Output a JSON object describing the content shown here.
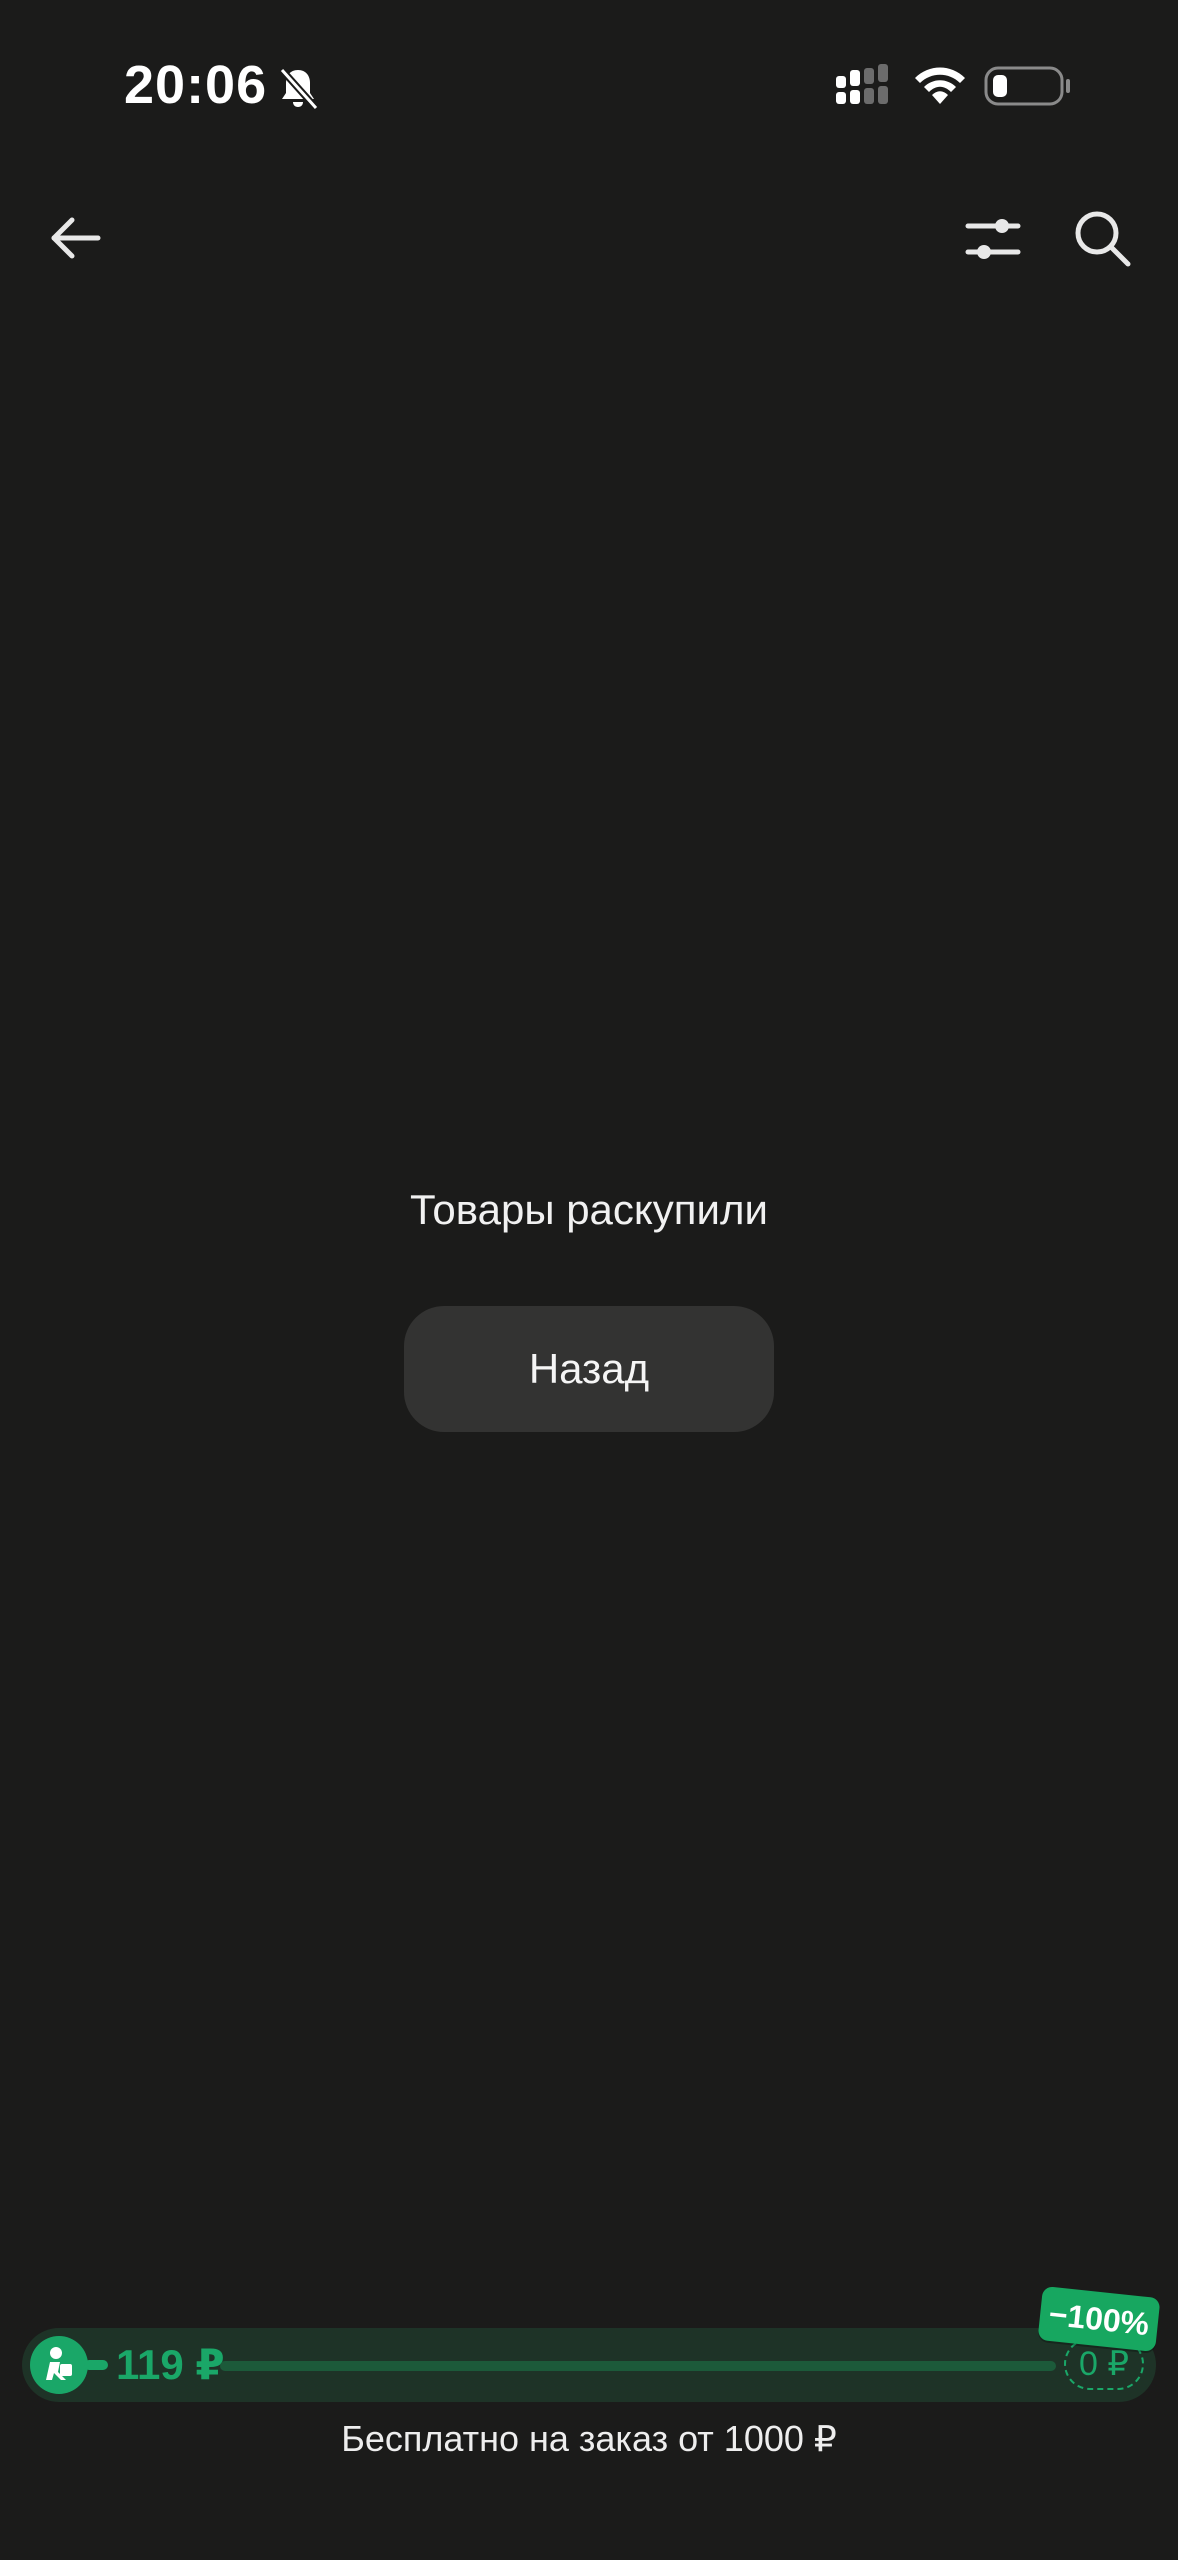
{
  "status_bar": {
    "time": "20:06",
    "icons": [
      "bell-off-icon",
      "signal-icon",
      "wifi-icon",
      "battery-icon"
    ]
  },
  "header": {
    "icons": [
      "back-arrow-icon",
      "filter-sliders-icon",
      "search-icon"
    ]
  },
  "empty_state": {
    "message": "Товары раскупили",
    "button_label": "Назад"
  },
  "delivery": {
    "current_price": "119 ₽",
    "target_price": "0 ₽",
    "discount": "−100%",
    "caption": "Бесплатно на заказ от 1000 ₽",
    "progress": 0.0
  },
  "colors": {
    "background": "#1b1b1a",
    "accent_green": "#1aa768",
    "button_bg": "#333332"
  }
}
